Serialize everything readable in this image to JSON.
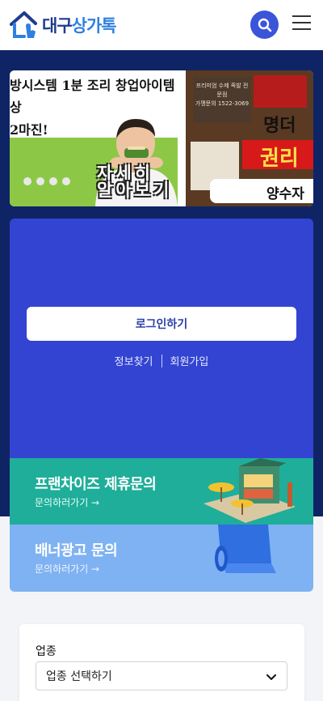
{
  "header": {
    "logo_part1": "대구",
    "logo_part2": "상가톡",
    "search_icon": "search-icon",
    "menu_icon": "hamburger-menu-icon"
  },
  "banner": {
    "left_slide": {
      "line1": "방시스템 1분 조리 창업아이템",
      "line2": "상",
      "line3": "2마진!",
      "cta_line1": "자세히",
      "cta_line2": "알아보기"
    },
    "right_slide": {
      "sign_text": "프리미엄 수제 족발 전문점",
      "sign_phone": "가맹문의 1522-3069",
      "headline": "명더",
      "badge": "권리",
      "footer": "양수자"
    },
    "dots": 4
  },
  "login": {
    "button_label": "로그인하기",
    "find_info": "정보찾기",
    "signup": "회원가입"
  },
  "promos": {
    "franchise": {
      "title": "프랜차이즈 제휴문의",
      "sub": "문의하러가기 →"
    },
    "banner_ad": {
      "title": "배너광고 문의",
      "sub": "문의하러가기 →"
    }
  },
  "filter": {
    "label": "업종",
    "placeholder": "업종 선택하기"
  },
  "colors": {
    "brand_navy": "#0f2464",
    "login_blue": "#3344d2",
    "teal": "#1fae99",
    "light_blue": "#7fb2f2",
    "accent": "#3a55d9"
  }
}
